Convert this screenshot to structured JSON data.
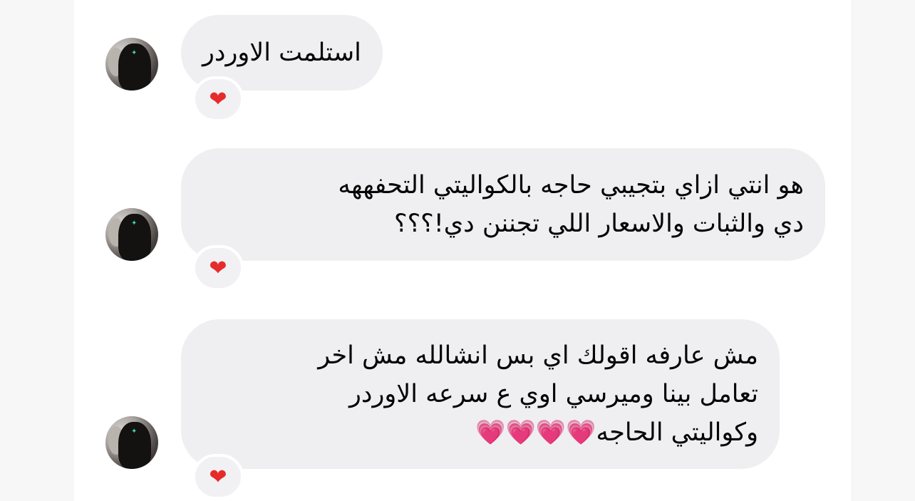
{
  "messages": [
    {
      "lines": [
        "استلمت الاوردر"
      ],
      "reaction": "❤"
    },
    {
      "lines": [
        "هو انتي ازاي بتجيبي حاجه بالكواليتي التحفههه",
        "دي والثبات والاسعار اللي تجننن دي!؟؟؟"
      ],
      "reaction": "❤"
    },
    {
      "lines": [
        "مش عارفه اقولك اي بس انشالله مش اخر",
        "تعامل بينا وميرسي اوي ع سرعه الاوردر",
        "وكواليتي الحاجه"
      ],
      "trailing_emoji": "💗💗💗💗",
      "reaction": "❤"
    }
  ],
  "colors": {
    "bubble_bg": "#efeff1",
    "reaction_heart": "#e62b2b",
    "emoji_pink": "#f06fb8"
  },
  "icons": {
    "avatar": "user-avatar-photo",
    "reaction": "red-heart-icon",
    "inline_emoji": "growing-heart-emoji"
  }
}
